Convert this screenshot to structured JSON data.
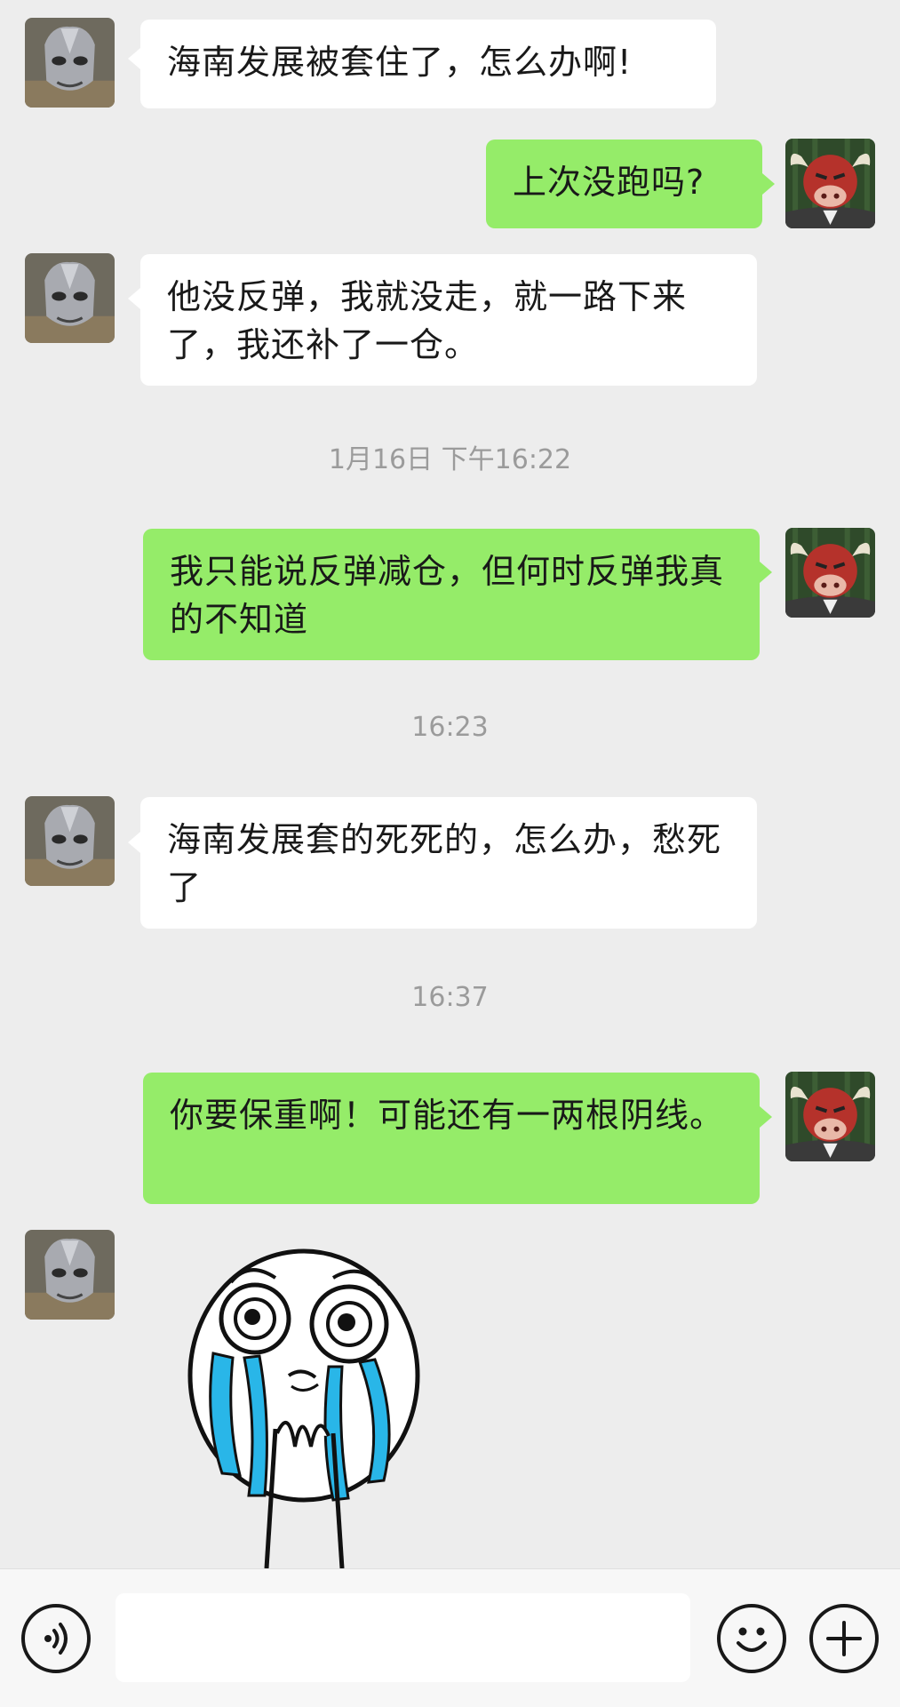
{
  "messages": [
    {
      "side": "in",
      "text": "海南发展被套住了，怎么办啊!"
    },
    {
      "side": "out",
      "text": "上次没跑吗?"
    },
    {
      "side": "in",
      "text": "他没反弹，我就没走，就一路下来了，我还补了一仓。"
    },
    {
      "side": "out",
      "text": "我只能说反弹减仓，但何时反弹我真的不知道"
    },
    {
      "side": "in",
      "text": "海南发展套的死死的，怎么办，愁死了"
    },
    {
      "side": "out",
      "text": "你要保重啊！可能还有一两根阴线。"
    }
  ],
  "timestamps": [
    "1月16日 下午16:22",
    "16:23",
    "16:37"
  ],
  "sticker": {
    "icon": "crying-face-sticker"
  },
  "input": {
    "placeholder": "",
    "value": ""
  },
  "toolbar": {
    "voice_icon": "voice-icon",
    "emoji_icon": "emoji-icon",
    "more_icon": "plus-icon"
  },
  "colors": {
    "background": "#ededed",
    "incoming_bubble": "#ffffff",
    "outgoing_bubble": "#95ec69",
    "timestamp": "#9b9b9b",
    "tears": "#29b6e8"
  }
}
